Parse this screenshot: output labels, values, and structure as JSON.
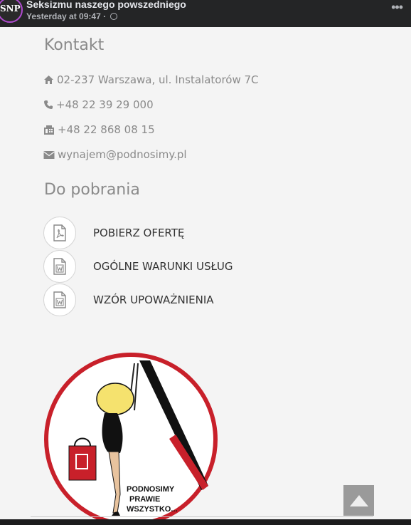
{
  "post": {
    "page_name": "Seksizmu naszego powszedniego",
    "timestamp": "Yesterday at 09:47",
    "separator": " · ",
    "avatar_text": "SNP",
    "more_icon": "more-icon"
  },
  "contact": {
    "heading": "Kontakt",
    "address": "02-237 Warszawa, ul. Instalatorów 7C",
    "phone": "+48 22 39 29 000",
    "fax": "+48 22 868 08 15",
    "email": "wynajem@podnosimy.pl"
  },
  "downloads": {
    "heading": "Do pobrania",
    "items": [
      {
        "label": "POBIERZ OFERTĘ",
        "icon": "pdf-file-icon"
      },
      {
        "label": "OGÓLNE WARUNKI USŁUG",
        "icon": "word-file-icon"
      },
      {
        "label": "WZÓR UPOWAŻNIENIA",
        "icon": "word-file-icon"
      }
    ]
  },
  "logo": {
    "line1": "PODNOSIMY",
    "line2": "PRAWIE",
    "line3": "WSZYSTKO..."
  },
  "colors": {
    "accent_red": "#c8202a",
    "icon_gray": "#8a8a8a"
  }
}
